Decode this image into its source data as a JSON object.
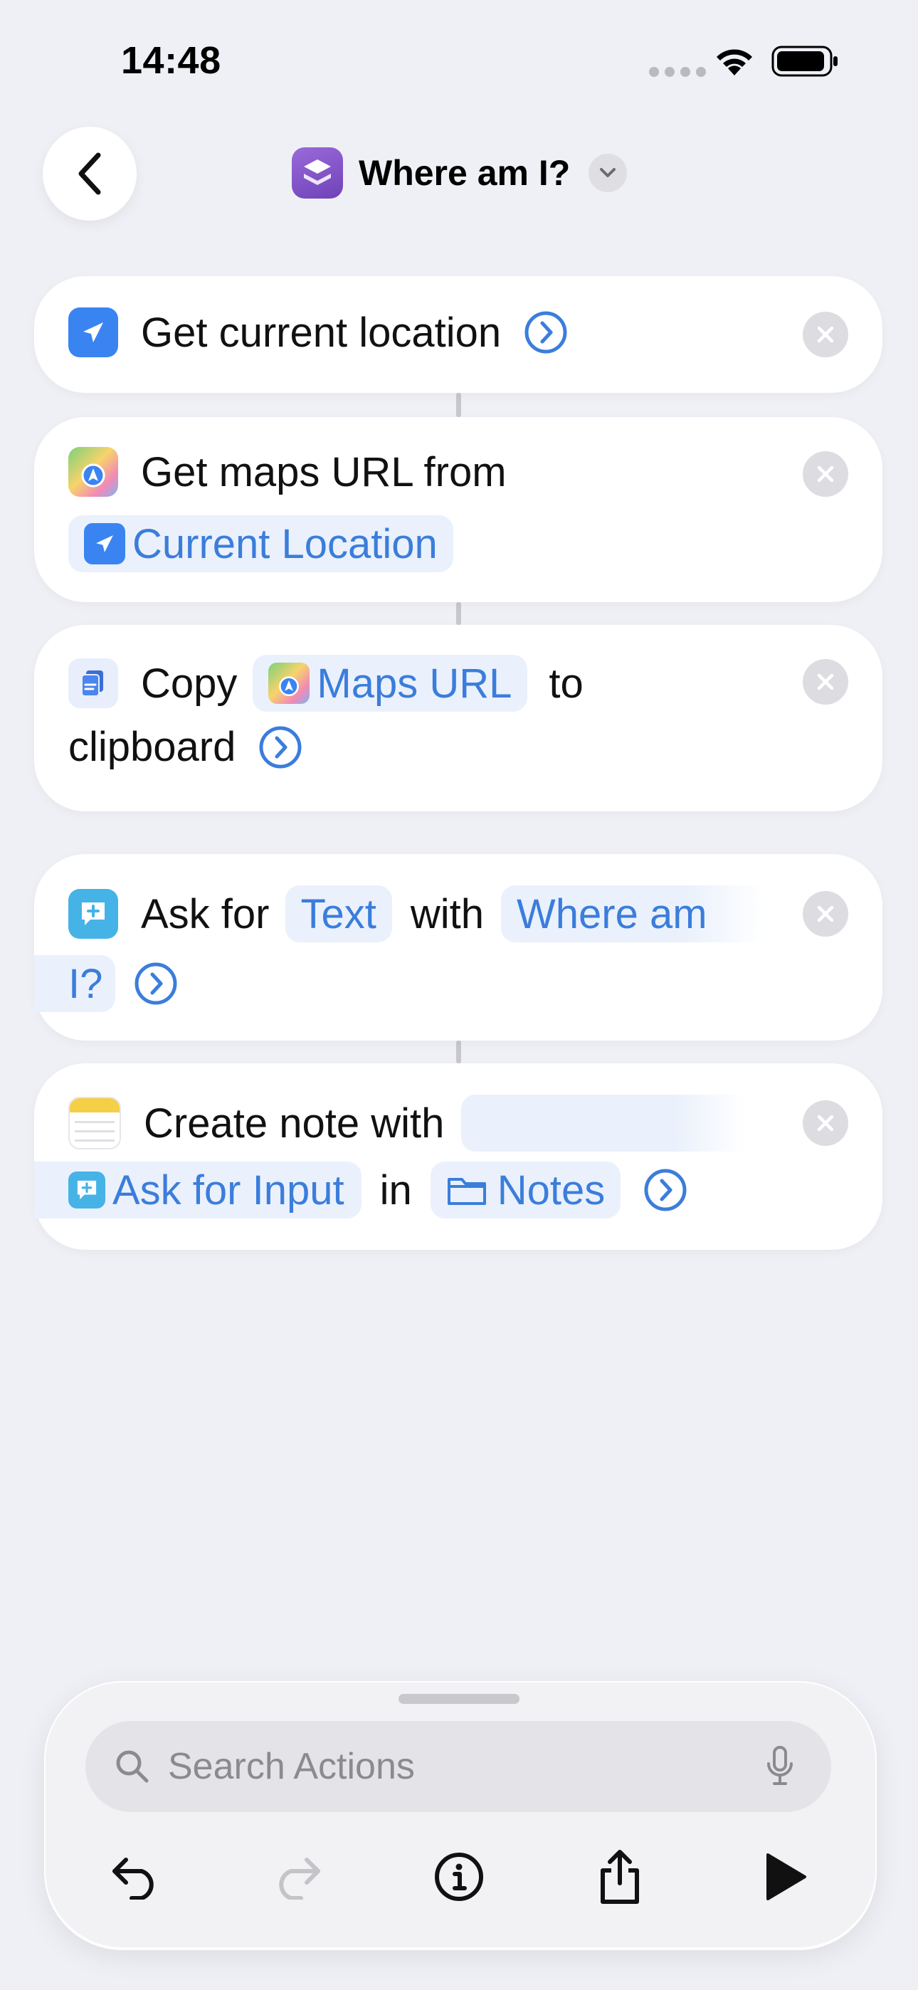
{
  "status_bar": {
    "time": "14:48",
    "icons": [
      "cellular-dots-icon",
      "wifi-icon",
      "battery-icon"
    ]
  },
  "nav": {
    "back_icon": "chevron-left-icon",
    "title": "Where am I?",
    "title_icon": "shortcuts-app-icon",
    "dropdown_icon": "chevron-down-icon"
  },
  "actions": [
    {
      "id": "get-location",
      "line1": "Get current location",
      "icon": "location-arrow-icon",
      "color": "#3a84f2"
    },
    {
      "id": "get-maps-url",
      "line1": "Get maps URL from",
      "variable": "Current Location",
      "icon": "maps-app-icon"
    },
    {
      "id": "copy-clipboard",
      "word_copy": "Copy",
      "variable": "Maps URL",
      "word_to": "to",
      "line2": "clipboard",
      "icon": "document-copy-icon"
    },
    {
      "id": "ask-for-input",
      "word_ask": "Ask for",
      "type_param": "Text",
      "word_with": "with",
      "prompt_part1": "Where am",
      "prompt_part2": "I?",
      "icon": "chat-bubble-plus-icon",
      "color": "#46b3e6"
    },
    {
      "id": "create-note",
      "line1": "Create note with",
      "variable": "Ask for Input",
      "word_in": "in",
      "folder": "Notes",
      "icon": "notes-app-icon"
    }
  ],
  "bottom": {
    "search_placeholder": "Search Actions",
    "search_icon": "magnifier-icon",
    "mic_icon": "microphone-icon",
    "toolbar": [
      "undo-icon",
      "redo-icon",
      "info-icon",
      "share-icon",
      "play-icon"
    ]
  },
  "colors": {
    "background": "#eff0f5",
    "accent_blue": "#3b7ddb",
    "pill_bg": "#eaf1fc"
  }
}
